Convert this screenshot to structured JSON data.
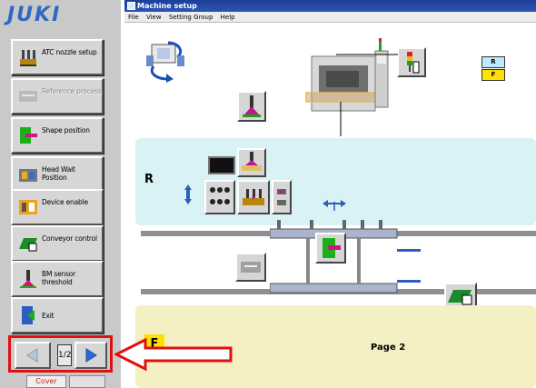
{
  "brand": "JUKI",
  "window": {
    "title": "Machine setup"
  },
  "menu": [
    "File",
    "View",
    "Setting Group",
    "Help"
  ],
  "sidebar": {
    "items": [
      {
        "label": "ATC nozzle setup",
        "enabled": true,
        "icon": "atc-nozzle-icon"
      },
      {
        "label": "Reference process",
        "enabled": false,
        "icon": "reference-icon"
      },
      {
        "label": "Shape position",
        "enabled": true,
        "icon": "shape-position-icon"
      },
      {
        "label": "Head Wait Position",
        "enabled": true,
        "icon": "head-wait-icon"
      },
      {
        "label": "Device enable",
        "enabled": true,
        "icon": "device-enable-icon"
      },
      {
        "label": "Conveyor control",
        "enabled": true,
        "icon": "conveyor-icon"
      },
      {
        "label": "BM sensor threshold",
        "enabled": true,
        "icon": "bm-sensor-icon"
      },
      {
        "label": "Exit",
        "enabled": true,
        "icon": "exit-icon"
      }
    ],
    "pager": {
      "page": "1/2"
    },
    "cover_label": "Cover"
  },
  "sections": {
    "rear": "R",
    "front": "F"
  },
  "badges": {
    "rear": "R",
    "front": "F"
  },
  "annotation": {
    "label": "Page 2"
  },
  "colors": {
    "accent": "#e01010",
    "title": "#1c3e97",
    "rear_bg": "#d9f2f6",
    "front_bg": "#f4f0c4"
  }
}
